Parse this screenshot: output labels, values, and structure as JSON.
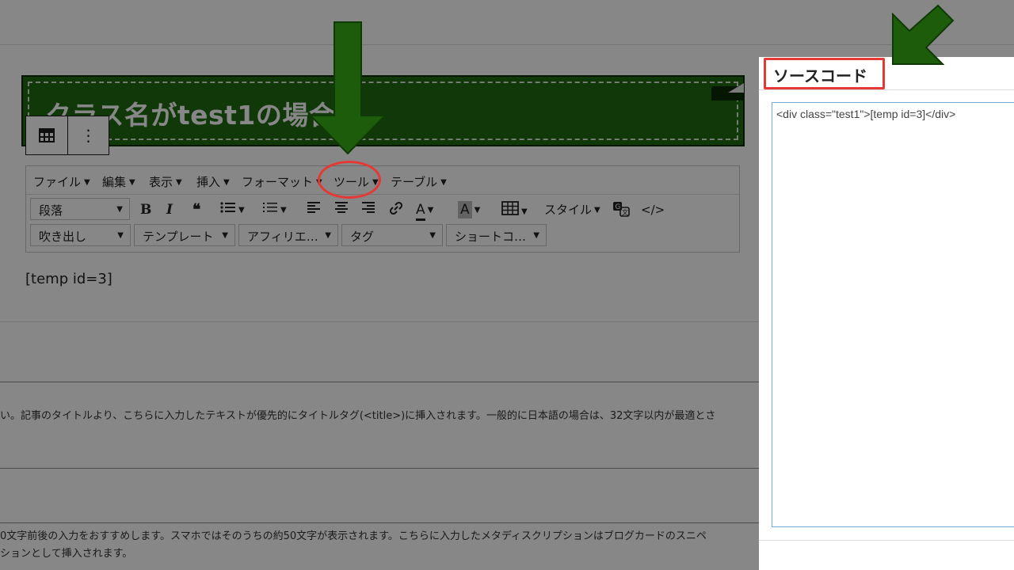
{
  "editor": {
    "heading_text": "クラス名がtest1の場合",
    "block_toolbar": {
      "table_icon": "table-icon",
      "more_icon": "more-vertical-icon"
    },
    "menubar": [
      {
        "label": "ファイル"
      },
      {
        "label": "編集"
      },
      {
        "label": "表示"
      },
      {
        "label": "挿入"
      },
      {
        "label": "フォーマット"
      },
      {
        "label": "ツール"
      },
      {
        "label": "テーブル"
      }
    ],
    "toolbar_row1": {
      "format_select": "段落",
      "buttons": {
        "bold": "B",
        "italic": "I",
        "quote": "66",
        "style_label": "スタイル"
      }
    },
    "toolbar_row2": {
      "balloon": "吹き出し",
      "template": "テンプレート",
      "affiliate": "アフィリエ…",
      "tag": "タグ",
      "shortcode": "ショートコ…"
    },
    "paragraph_text": "[temp id=3]"
  },
  "help": {
    "title_help": "い。記事のタイトルより、こちらに入力したテキストが優先的にタイトルタグ(<title>)に挿入されます。一般的に日本語の場合は、32文字以内が最適とさ",
    "desc_help_line1": "0文字前後の入力をおすすめします。スマホではそのうちの約50文字が表示されます。こちらに入力したメタディスクリプションはブログカードのスニペ",
    "desc_help_line2": "ションとして挿入されます。"
  },
  "dialog": {
    "title": "ソースコード",
    "code": "<div class=\"test1\">[temp id=3]</div>"
  },
  "colors": {
    "heading_bg": "#1f6b10",
    "arrow": "#1d5c0b",
    "highlight": "#e53935",
    "code_border": "#7aa7d6"
  }
}
